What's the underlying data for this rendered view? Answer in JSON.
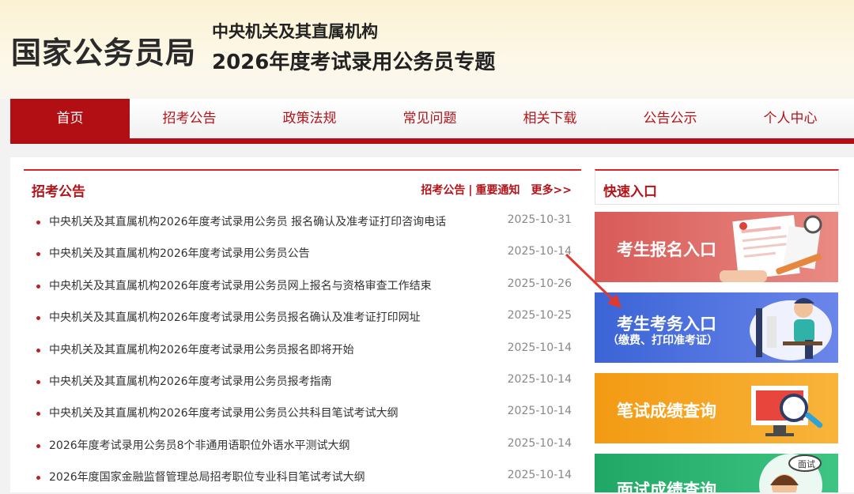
{
  "header": {
    "logo": "国家公务员局",
    "subtitle1": "中央机关及其直属机构",
    "subtitle2": "2026年度考试录用公务员专题"
  },
  "nav": {
    "items": [
      "首页",
      "招考公告",
      "政策法规",
      "常见问题",
      "相关下载",
      "公告公示",
      "个人中心"
    ],
    "active_index": 0
  },
  "news": {
    "title": "招考公告",
    "links": [
      "招考公告",
      "重要通知"
    ],
    "separator": "|",
    "more": "更多>>",
    "items": [
      {
        "title": "中央机关及其直属机构2026年度考试录用公务员 报名确认及准考证打印咨询电话",
        "date": "2025-10-31"
      },
      {
        "title": "中央机关及其直属机构2026年度考试录用公务员公告",
        "date": "2025-10-14"
      },
      {
        "title": "中央机关及其直属机构2026年度考试录用公务员网上报名与资格审查工作结束",
        "date": "2025-10-26"
      },
      {
        "title": "中央机关及其直属机构2026年度考试录用公务员报名确认及准考证打印网址",
        "date": "2025-10-25"
      },
      {
        "title": "中央机关及其直属机构2026年度考试录用公务员报名即将开始",
        "date": "2025-10-14"
      },
      {
        "title": "中央机关及其直属机构2026年度考试录用公务员报考指南",
        "date": "2025-10-14"
      },
      {
        "title": "中央机关及其直属机构2026年度考试录用公务员公共科目笔试考试大纲",
        "date": "2025-10-14"
      },
      {
        "title": "2026年度考试录用公务员8个非通用语职位外语水平测试大纲",
        "date": "2025-10-14"
      },
      {
        "title": "2026年度国家金融监督管理总局招考职位专业科目笔试考试大纲",
        "date": "2025-10-14"
      }
    ]
  },
  "quick": {
    "title": "快速入口",
    "entries": [
      {
        "label": "考生报名入口",
        "sub": "",
        "color": "#d85b58"
      },
      {
        "label": "考生考务入口",
        "sub": "（缴费、打印准考证）",
        "color": "#3b64d6"
      },
      {
        "label": "笔试成绩查询",
        "sub": "",
        "color": "#f39a13"
      },
      {
        "label": "面试成绩查询",
        "sub": "",
        "color": "#21a765"
      }
    ],
    "badge_text": "面试"
  },
  "colors": {
    "brand_red": "#b20f14",
    "accent_red": "#d4262b"
  }
}
